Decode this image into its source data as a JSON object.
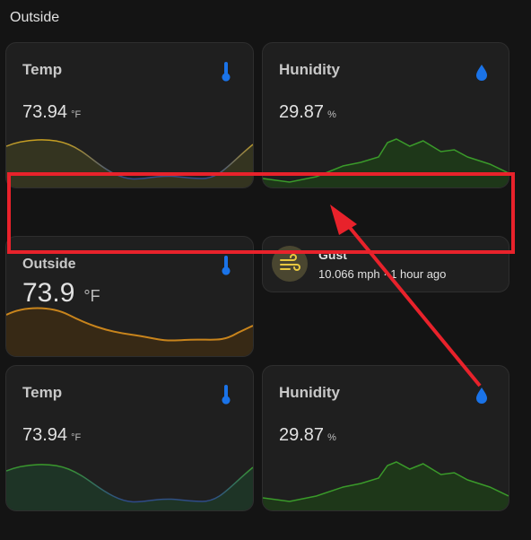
{
  "section": {
    "title": "Outside"
  },
  "cards": {
    "temp1": {
      "name": "Temp",
      "value": "73.94",
      "unit": "°F"
    },
    "hum1": {
      "name": "Hunidity",
      "value": "29.87",
      "unit": "%"
    },
    "outside": {
      "name": "Outside",
      "value": "73.9",
      "unit": "°F"
    },
    "gust": {
      "name": "Gust",
      "info": "10.066 mph · 1 hour ago"
    },
    "temp2": {
      "name": "Temp",
      "value": "73.94",
      "unit": "°F"
    },
    "hum2": {
      "name": "Hunidity",
      "value": "29.87",
      "unit": "%"
    }
  },
  "colors": {
    "accent_icon": "#1a73e8",
    "temp_graph_warm": "#c8a020",
    "temp_graph_cool": "#2e4a8a",
    "humidity_graph": "#3a9a2a",
    "outside_graph": "#c8841c",
    "gust_icon": "#e8c840",
    "annotation": "#e8222b"
  },
  "icons": {
    "temp": "thermometer-icon",
    "humidity": "water-percent-icon",
    "gust": "wind-icon"
  }
}
